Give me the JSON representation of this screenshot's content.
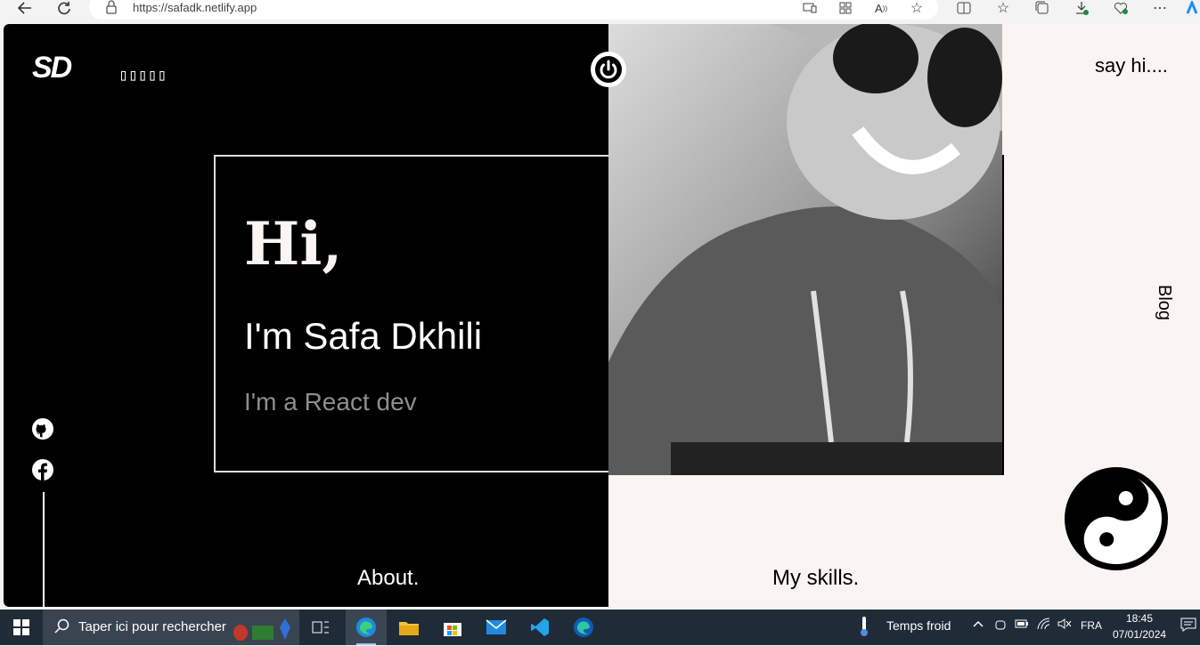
{
  "browser": {
    "url": "https://safadk.netlify.app"
  },
  "site": {
    "logo": "SD",
    "menu_glyph": "▯▯▯▯▯",
    "say_hi": "say hi....",
    "blog": "Blog",
    "greeting": "Hi,",
    "name_line": "I'm Safa Dkhili",
    "role_line": "I'm a React dev",
    "about": "About.",
    "skills": "My skills."
  },
  "taskbar": {
    "search_placeholder": "Taper ici pour rechercher",
    "weather": "Temps froid",
    "language": "FRA",
    "time": "18:45",
    "date": "07/01/2024"
  }
}
